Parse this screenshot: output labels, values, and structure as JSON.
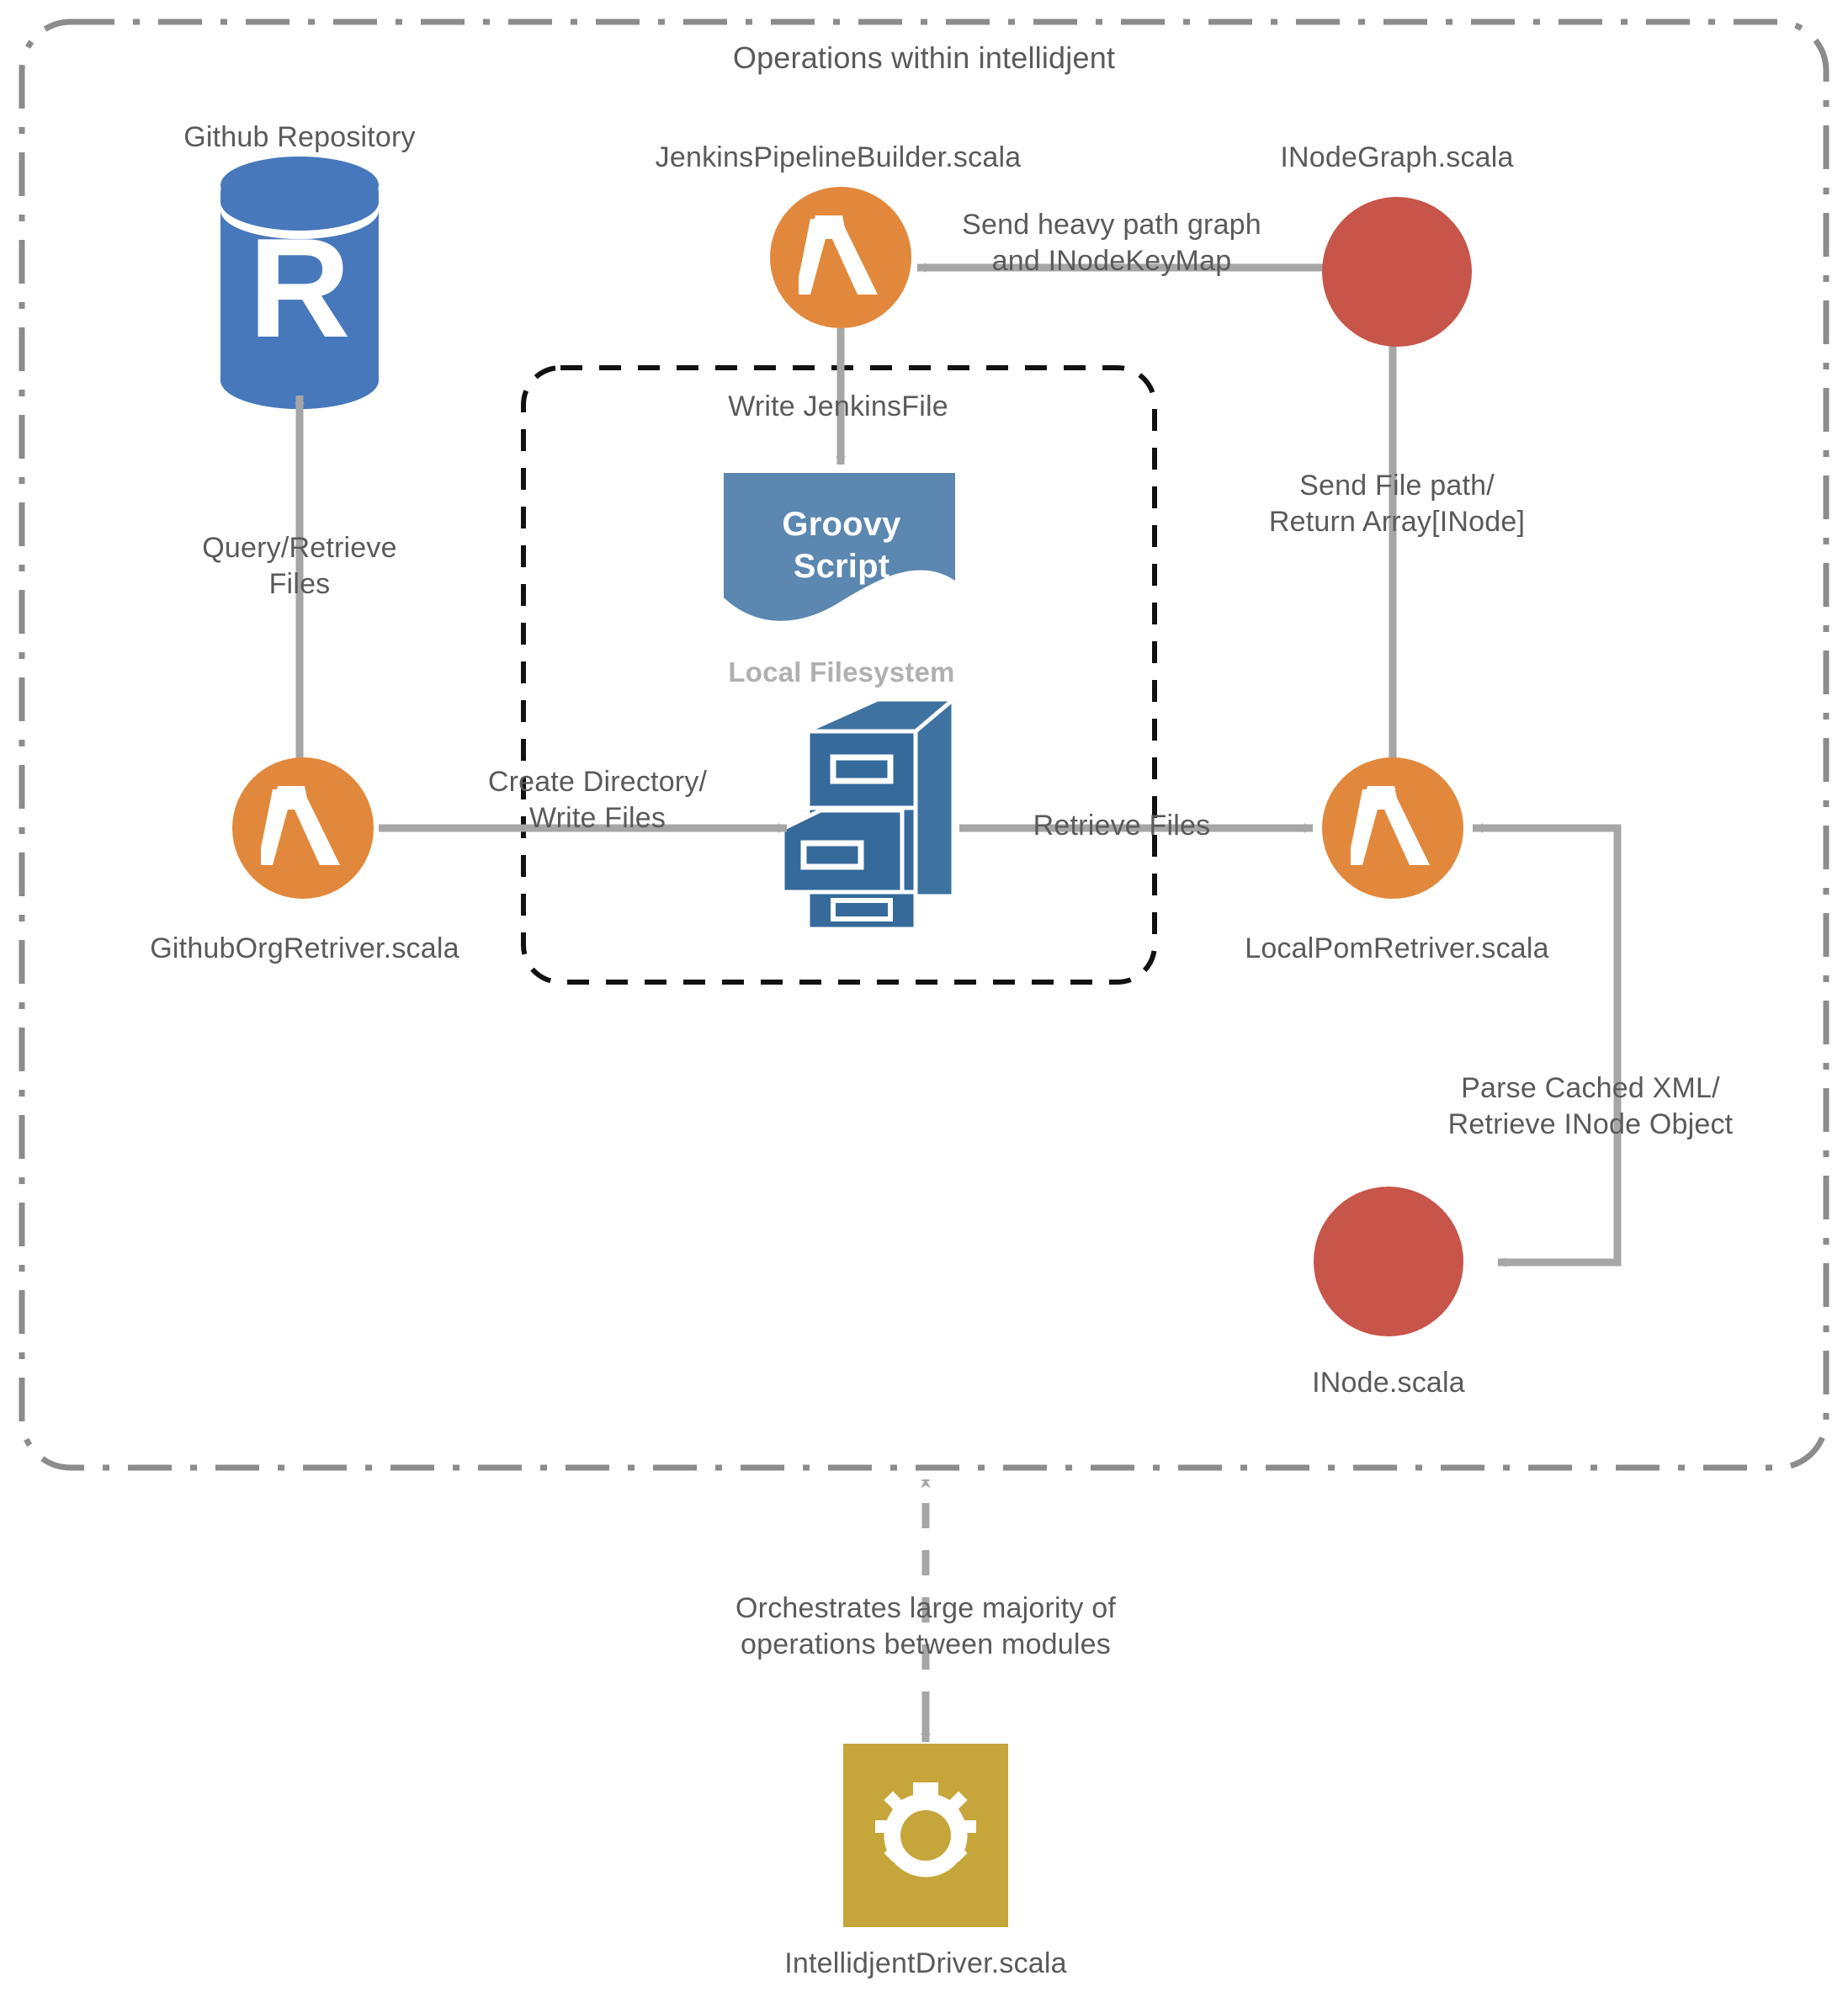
{
  "diagram": {
    "title": "Operations within intellidjent",
    "boundary_label": "Operations within intellidjent",
    "inner_group_label": "Local Filesystem"
  },
  "colors": {
    "lambda_orange": "#E2883C",
    "repo_blue": "#4878BC",
    "inode_red": "#C7554A",
    "groovy_blue": "#5B87B0",
    "cabinet_blue": "#356A9B",
    "driver_gold": "#C6A53B",
    "arrow_gray": "#A6A6A6",
    "text_gray": "#5A5A5A",
    "muted_gray": "#B0B0B0"
  },
  "nodes": {
    "github_repository": {
      "label": "Github Repository",
      "icon": "database-cylinder-icon",
      "glyph": "R"
    },
    "github_org_retriver": {
      "label": "GithubOrgRetriver.scala",
      "icon": "lambda-icon"
    },
    "jenkins_pipeline_builder": {
      "label": "JenkinsPipelineBuilder.scala",
      "icon": "lambda-icon"
    },
    "inode_graph": {
      "label": "INodeGraph.scala",
      "icon": "red-circle-icon"
    },
    "groovy_script": {
      "label": "Groovy Script",
      "icon": "document-wave-icon"
    },
    "file_cabinet": {
      "label": "",
      "icon": "file-cabinet-icon"
    },
    "local_pom_retriver": {
      "label": "LocalPomRetriver.scala",
      "icon": "lambda-icon"
    },
    "inode": {
      "label": "INode.scala",
      "icon": "red-circle-icon"
    },
    "intellidjent_driver": {
      "label": "IntellidjentDriver.scala",
      "icon": "gear-icon"
    }
  },
  "edges": {
    "query_retrieve_files": "Query/Retrieve\nFiles",
    "create_directory_write_files": "Create Directory/\nWrite Files",
    "write_jenkinsfile": "Write JenkinsFile",
    "send_heavy_path_graph": "Send heavy path graph\nand INodeKeyMap",
    "send_file_path_return_array": "Send File path/\nReturn Array[INode]",
    "retrieve_files": "Retrieve Files",
    "parse_cached_xml": "Parse Cached XML/\nRetrieve INode Object",
    "orchestrates": "Orchestrates large majority of\noperations between modules"
  }
}
